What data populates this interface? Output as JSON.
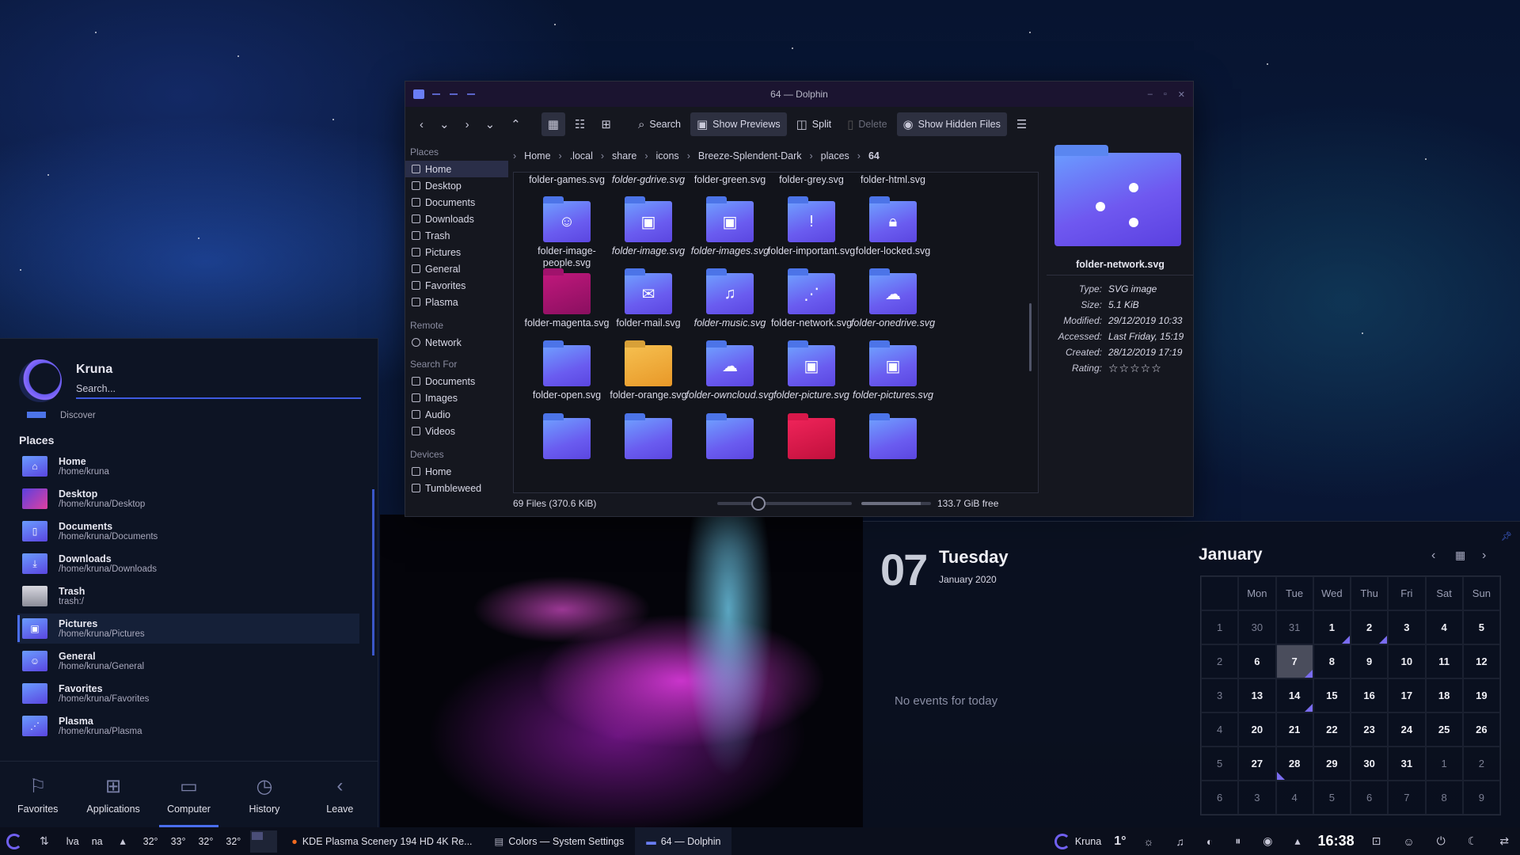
{
  "dolphin": {
    "title": "64 — Dolphin",
    "toolbar": {
      "search": "Search",
      "show_previews": "Show Previews",
      "split": "Split",
      "delete": "Delete",
      "show_hidden": "Show Hidden Files"
    },
    "places": {
      "header_places": "Places",
      "items": [
        "Home",
        "Desktop",
        "Documents",
        "Downloads",
        "Trash",
        "Pictures",
        "General",
        "Favorites",
        "Plasma"
      ],
      "header_remote": "Remote",
      "remote_items": [
        "Network"
      ],
      "header_search": "Search For",
      "search_items": [
        "Documents",
        "Images",
        "Audio",
        "Videos"
      ],
      "header_devices": "Devices",
      "device_items": [
        "Home",
        "Tumbleweed"
      ]
    },
    "breadcrumb": [
      "Home",
      ".local",
      "share",
      "icons",
      "Breeze-Splendent-Dark",
      "places",
      "64"
    ],
    "files": {
      "row0": [
        "folder-games.svg",
        "folder-gdrive.svg",
        "folder-green.svg",
        "folder-grey.svg",
        "folder-html.svg"
      ],
      "row1": [
        "folder-image-people.svg",
        "folder-image.svg",
        "folder-images.svg",
        "folder-important.svg",
        "folder-locked.svg"
      ],
      "row2": [
        "folder-magenta.svg",
        "folder-mail.svg",
        "folder-music.svg",
        "folder-network.svg",
        "folder-onedrive.svg"
      ],
      "row3": [
        "folder-open.svg",
        "folder-orange.svg",
        "folder-owncloud.svg",
        "folder-picture.svg",
        "folder-pictures.svg"
      ]
    },
    "info": {
      "filename": "folder-network.svg",
      "type_label": "Type:",
      "type": "SVG image",
      "size_label": "Size:",
      "size": "5.1 KiB",
      "modified_label": "Modified:",
      "modified": "29/12/2019 10:33",
      "accessed_label": "Accessed:",
      "accessed": "Last Friday, 15:19",
      "created_label": "Created:",
      "created": "28/12/2019 17:19",
      "rating_label": "Rating:",
      "rating": "☆☆☆☆☆"
    },
    "status": {
      "count": "69 Files (370.6 KiB)",
      "free": "133.7 GiB free",
      "zoom_fraction": 0.28,
      "disk_used_fraction": 0.85
    }
  },
  "launcher": {
    "user": "Kruna",
    "search_placeholder": "Search...",
    "discover": "Discover",
    "section": "Places",
    "places": [
      {
        "name": "Home",
        "path": "/home/kruna"
      },
      {
        "name": "Desktop",
        "path": "/home/kruna/Desktop"
      },
      {
        "name": "Documents",
        "path": "/home/kruna/Documents"
      },
      {
        "name": "Downloads",
        "path": "/home/kruna/Downloads"
      },
      {
        "name": "Trash",
        "path": "trash:/"
      },
      {
        "name": "Pictures",
        "path": "/home/kruna/Pictures"
      },
      {
        "name": "General",
        "path": "/home/kruna/General"
      },
      {
        "name": "Favorites",
        "path": "/home/kruna/Favorites"
      },
      {
        "name": "Plasma",
        "path": "/home/kruna/Plasma"
      }
    ],
    "tabs": [
      "Favorites",
      "Applications",
      "Computer",
      "History",
      "Leave"
    ],
    "active_tab": "Computer"
  },
  "calendar": {
    "day_number": "07",
    "day_name": "Tuesday",
    "month_year": "January 2020",
    "no_events": "No events for today",
    "month": "January",
    "weekdays": [
      "Mon",
      "Tue",
      "Wed",
      "Thu",
      "Fri",
      "Sat",
      "Sun"
    ],
    "weeks": [
      {
        "wk": "1",
        "days": [
          "30",
          "31",
          "1",
          "2",
          "3",
          "4",
          "5"
        ]
      },
      {
        "wk": "2",
        "days": [
          "6",
          "7",
          "8",
          "9",
          "10",
          "11",
          "12"
        ]
      },
      {
        "wk": "3",
        "days": [
          "13",
          "14",
          "15",
          "16",
          "17",
          "18",
          "19"
        ]
      },
      {
        "wk": "4",
        "days": [
          "20",
          "21",
          "22",
          "23",
          "24",
          "25",
          "26"
        ]
      },
      {
        "wk": "5",
        "days": [
          "27",
          "28",
          "29",
          "30",
          "31",
          "1",
          "2"
        ]
      },
      {
        "wk": "6",
        "days": [
          "3",
          "4",
          "5",
          "6",
          "7",
          "8",
          "9"
        ]
      }
    ]
  },
  "taskbar": {
    "kb1": "lva",
    "kb2": "na",
    "temps": [
      "32°",
      "33°",
      "32°",
      "32°"
    ],
    "tasks": [
      "KDE Plasma Scenery 194 HD 4K Re...",
      "Colors — System Settings",
      "64 — Dolphin"
    ],
    "user": "Kruna",
    "weather": "1°",
    "clock": "16:38"
  }
}
